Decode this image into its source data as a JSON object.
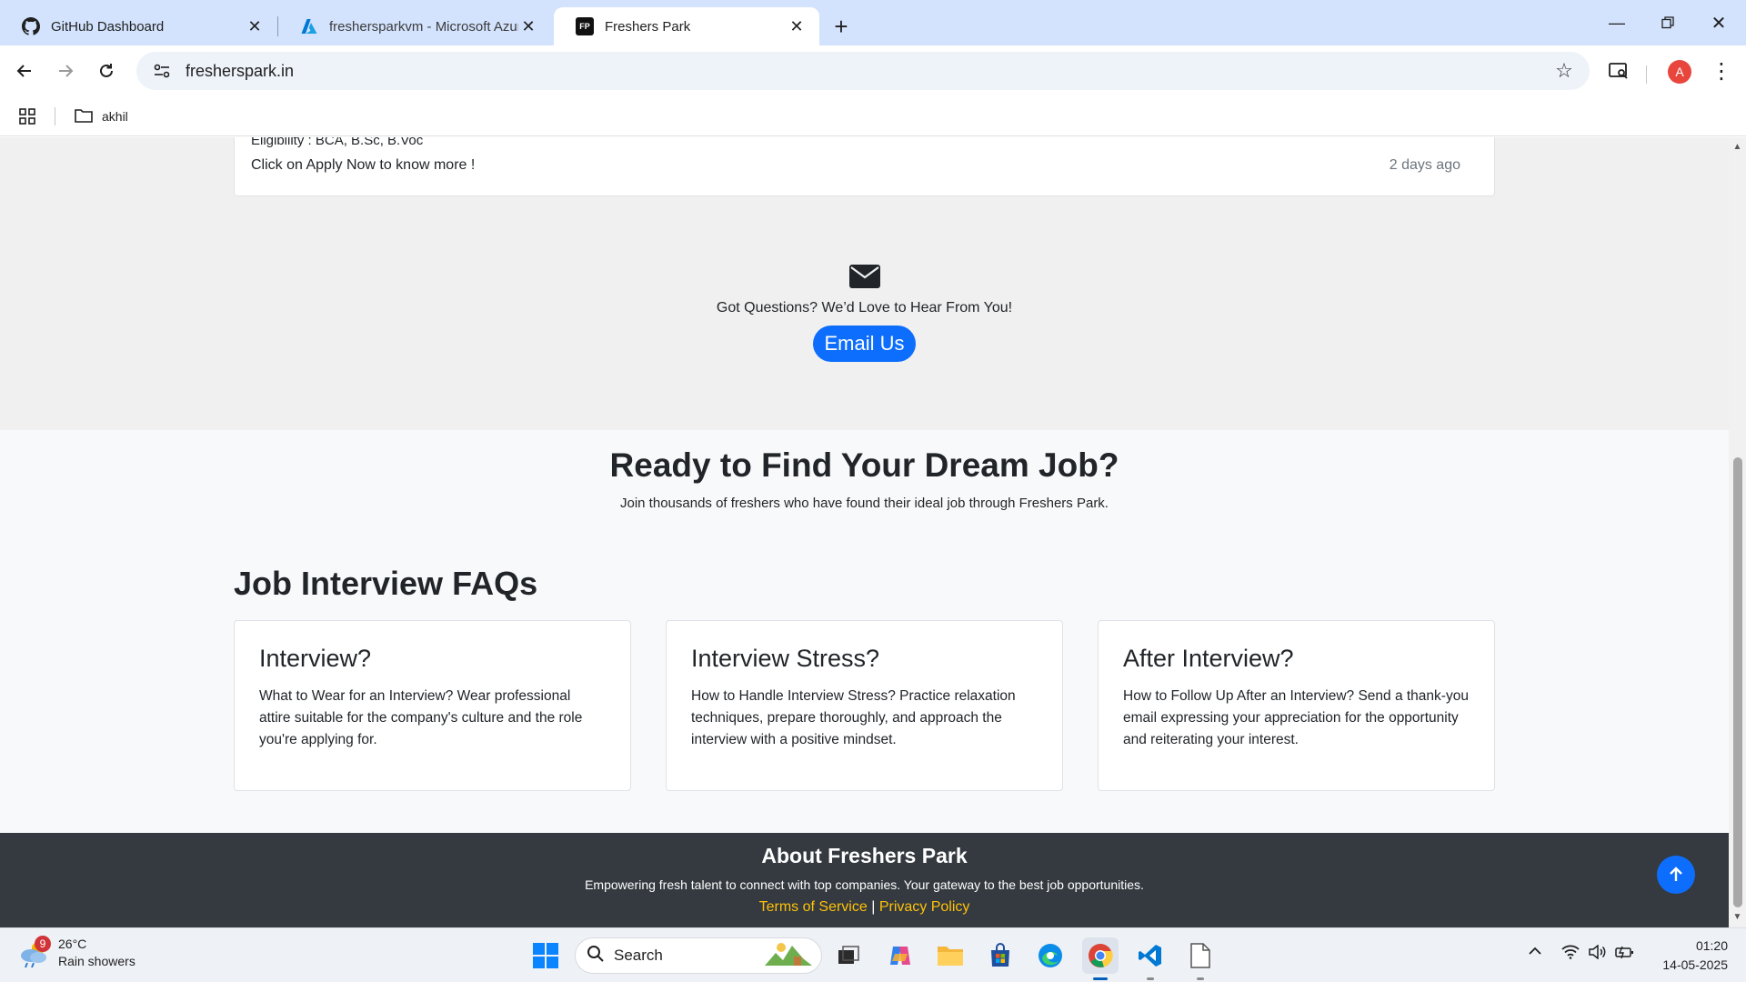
{
  "browser": {
    "tabs": [
      {
        "title": "GitHub Dashboard",
        "icon": "github-icon"
      },
      {
        "title": "freshersparkvm - Microsoft Azure",
        "icon": "azure-icon"
      },
      {
        "title": "Freshers Park",
        "icon": "freshers-park-favicon",
        "favicon_text": "FP"
      }
    ],
    "url": "fresherspark.in",
    "profile_initial": "A",
    "bookmark_folder": "akhil"
  },
  "page": {
    "job_card": {
      "eligibility": "Eligibility : BCA, B.Sc, B.Voc",
      "cta_text": "Click on Apply Now to know more !",
      "posted": "2 days ago"
    },
    "contact": {
      "question": "Got Questions? We’d Love to Hear From You!",
      "button_label": "Email Us"
    },
    "ready": {
      "title": "Ready to Find Your Dream Job?",
      "subtitle": "Join thousands of freshers who have found their ideal job through Freshers Park."
    },
    "faq": {
      "title": "Job Interview FAQs",
      "items": [
        {
          "title": "Interview?",
          "text": "What to Wear for an Interview? Wear professional attire suitable for the company's culture and the role you're applying for."
        },
        {
          "title": "Interview Stress?",
          "text": "How to Handle Interview Stress? Practice relaxation techniques, prepare thoroughly, and approach the interview with a positive mindset."
        },
        {
          "title": "After Interview?",
          "text": "How to Follow Up After an Interview? Send a thank-you email expressing your appreciation for the opportunity and reiterating your interest."
        }
      ]
    },
    "footer": {
      "title": "About Freshers Park",
      "tagline": "Empowering fresh talent to connect with top companies. Your gateway to the best job opportunities.",
      "terms": "Terms of Service",
      "separator": "|",
      "privacy": "Privacy Policy"
    }
  },
  "taskbar": {
    "weather": {
      "temp": "26°C",
      "condition": "Rain showers",
      "badge": "9"
    },
    "search_label": "Search",
    "time": "01:20",
    "date": "14-05-2025"
  },
  "colors": {
    "accent": "#0d6efd",
    "footer_bg": "#343a40",
    "footer_link": "#ffc107",
    "tabstrip": "#d3e3fd"
  }
}
